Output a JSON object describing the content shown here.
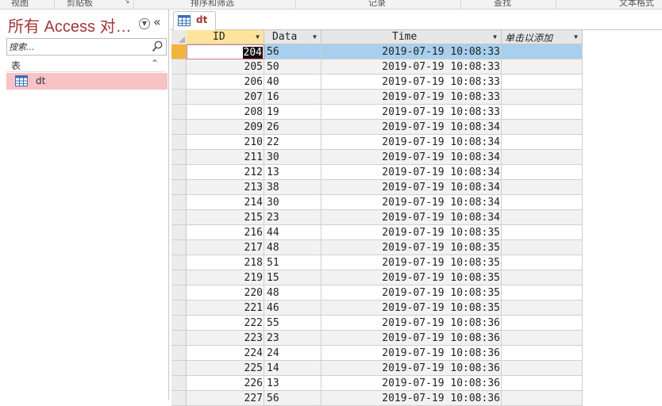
{
  "ribbon": {
    "groups": [
      "视图",
      "剪贴板",
      "排序和筛选",
      "记录",
      "查找",
      "文本格式"
    ]
  },
  "nav": {
    "title": "所有 Access 对…",
    "search_placeholder": "搜索...",
    "group_label": "表",
    "items": [
      {
        "label": "dt",
        "icon": "table-icon"
      }
    ]
  },
  "document": {
    "tab_label": "dt"
  },
  "datasheet": {
    "columns": [
      {
        "label": "ID"
      },
      {
        "label": "Data"
      },
      {
        "label": "Time"
      },
      {
        "label": "单击以添加"
      }
    ],
    "selected_row_index": 0,
    "rows": [
      {
        "id": "204",
        "data": "56",
        "time": "2019-07-19 10:08:33"
      },
      {
        "id": "205",
        "data": "50",
        "time": "2019-07-19 10:08:33"
      },
      {
        "id": "206",
        "data": "40",
        "time": "2019-07-19 10:08:33"
      },
      {
        "id": "207",
        "data": "16",
        "time": "2019-07-19 10:08:33"
      },
      {
        "id": "208",
        "data": "19",
        "time": "2019-07-19 10:08:33"
      },
      {
        "id": "209",
        "data": "26",
        "time": "2019-07-19 10:08:34"
      },
      {
        "id": "210",
        "data": "22",
        "time": "2019-07-19 10:08:34"
      },
      {
        "id": "211",
        "data": "30",
        "time": "2019-07-19 10:08:34"
      },
      {
        "id": "212",
        "data": "13",
        "time": "2019-07-19 10:08:34"
      },
      {
        "id": "213",
        "data": "38",
        "time": "2019-07-19 10:08:34"
      },
      {
        "id": "214",
        "data": "30",
        "time": "2019-07-19 10:08:34"
      },
      {
        "id": "215",
        "data": "23",
        "time": "2019-07-19 10:08:34"
      },
      {
        "id": "216",
        "data": "44",
        "time": "2019-07-19 10:08:35"
      },
      {
        "id": "217",
        "data": "48",
        "time": "2019-07-19 10:08:35"
      },
      {
        "id": "218",
        "data": "51",
        "time": "2019-07-19 10:08:35"
      },
      {
        "id": "219",
        "data": "15",
        "time": "2019-07-19 10:08:35"
      },
      {
        "id": "220",
        "data": "48",
        "time": "2019-07-19 10:08:35"
      },
      {
        "id": "221",
        "data": "46",
        "time": "2019-07-19 10:08:35"
      },
      {
        "id": "222",
        "data": "55",
        "time": "2019-07-19 10:08:36"
      },
      {
        "id": "223",
        "data": "23",
        "time": "2019-07-19 10:08:36"
      },
      {
        "id": "224",
        "data": "24",
        "time": "2019-07-19 10:08:36"
      },
      {
        "id": "225",
        "data": "14",
        "time": "2019-07-19 10:08:36"
      },
      {
        "id": "226",
        "data": "13",
        "time": "2019-07-19 10:08:36"
      },
      {
        "id": "227",
        "data": "56",
        "time": "2019-07-19 10:08:36"
      }
    ]
  },
  "colors": {
    "access_red": "#a4373a",
    "nav_selected": "#f8c2c6",
    "row_selected": "#a8d0ee",
    "header_active": "#fde49a"
  }
}
